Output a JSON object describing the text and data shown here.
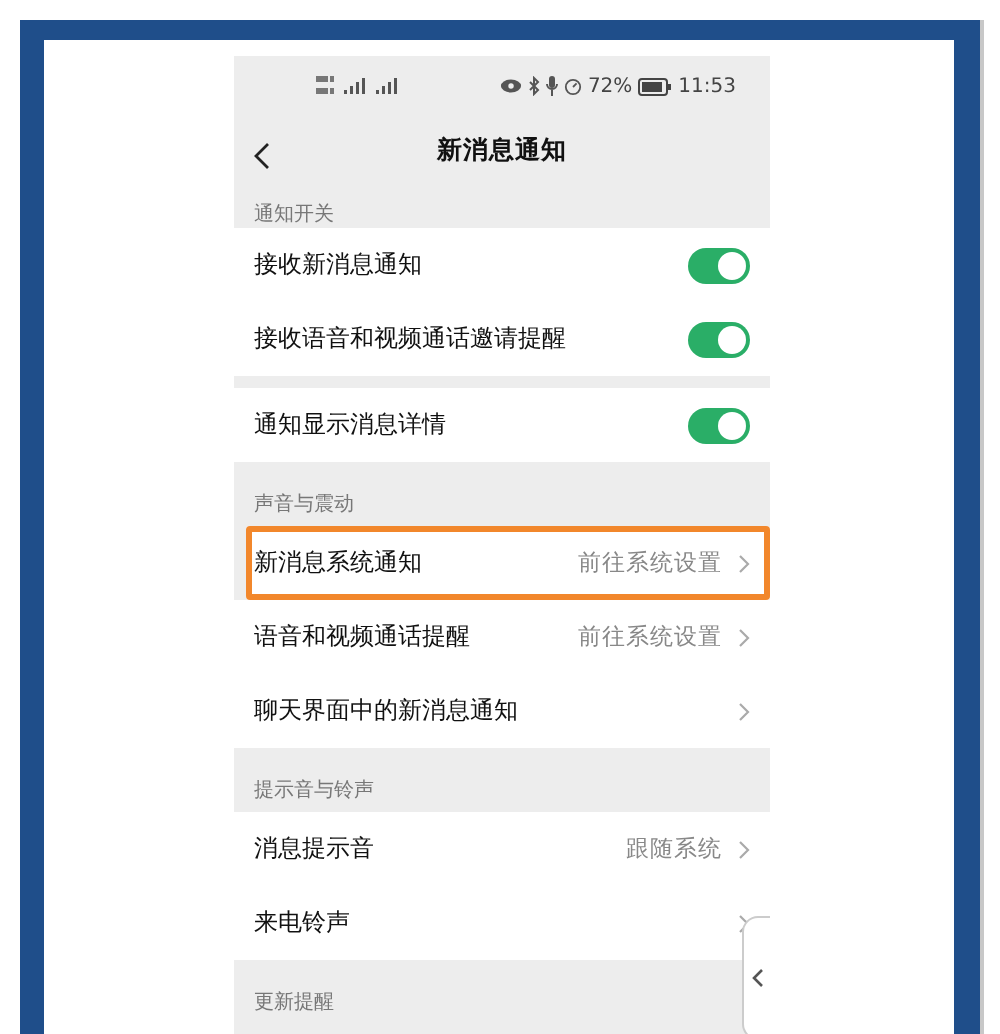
{
  "status_bar": {
    "battery": "72%",
    "time": "11:53"
  },
  "header": {
    "title": "新消息通知"
  },
  "sections": [
    {
      "title": "通知开关",
      "rows": [
        {
          "kind": "toggle",
          "label": "接收新消息通知",
          "on": true,
          "highlighted": false
        },
        {
          "kind": "toggle",
          "label": "接收语音和视频通话邀请提醒",
          "on": true,
          "highlighted": false
        },
        {
          "kind": "toggle",
          "label": "通知显示消息详情",
          "on": true,
          "highlighted": false
        }
      ]
    },
    {
      "title": "声音与震动",
      "rows": [
        {
          "kind": "link",
          "label": "新消息系统通知",
          "value": "前往系统设置",
          "highlighted": true
        },
        {
          "kind": "link",
          "label": "语音和视频通话提醒",
          "value": "前往系统设置",
          "highlighted": false
        },
        {
          "kind": "link",
          "label": "聊天界面中的新消息通知",
          "highlighted": false
        }
      ]
    },
    {
      "title": "提示音与铃声",
      "rows": [
        {
          "kind": "link",
          "label": "消息提示音",
          "value": "跟随系统",
          "highlighted": false
        },
        {
          "kind": "link",
          "label": "来电铃声",
          "highlighted": false
        }
      ]
    },
    {
      "title": "更新提醒"
    }
  ]
}
